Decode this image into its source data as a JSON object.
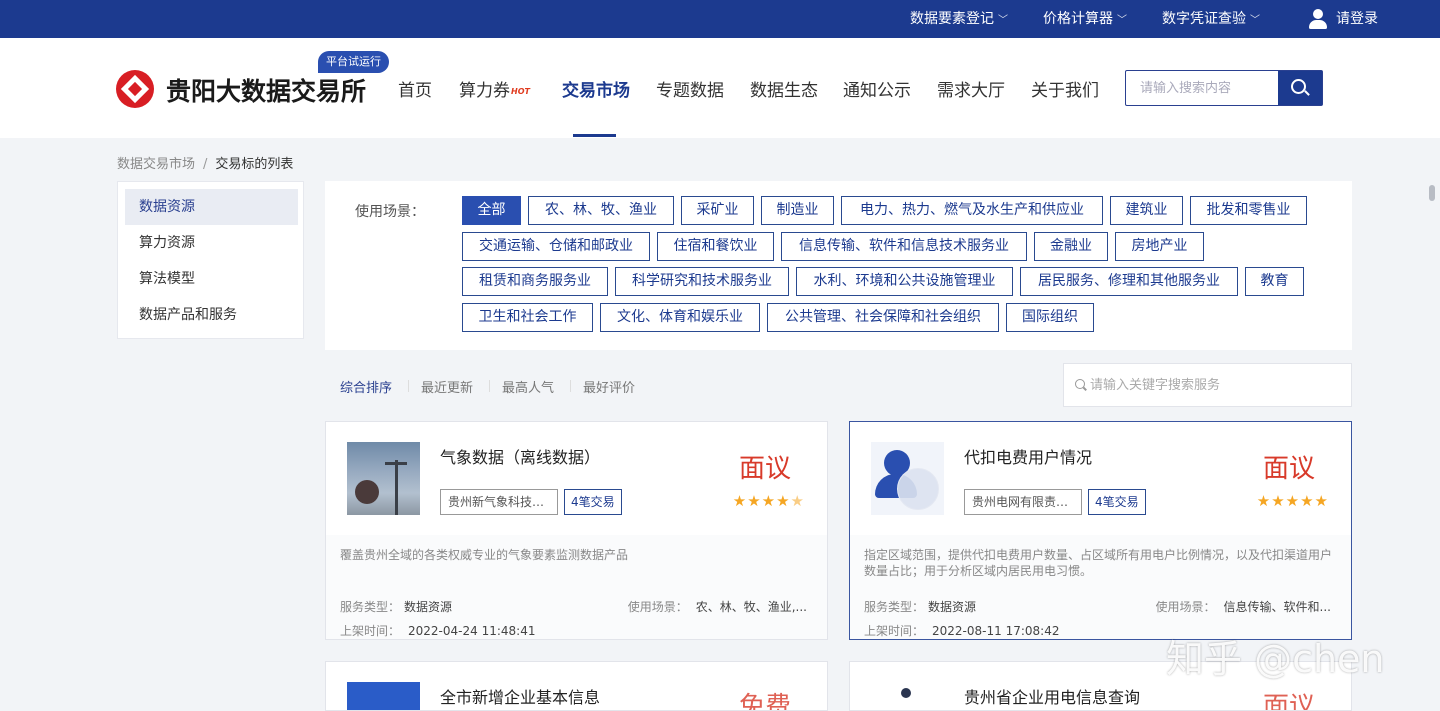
{
  "topbar": {
    "links": [
      {
        "label": "数据要素登记",
        "chevron": "﹀"
      },
      {
        "label": "价格计算器",
        "chevron": "﹀"
      },
      {
        "label": "数字凭证查验",
        "chevron": "﹀"
      }
    ],
    "login_label": "请登录"
  },
  "header": {
    "logo_text": "贵阳大数据交易所",
    "trial_badge": "平台试运行",
    "nav": [
      {
        "label": "首页"
      },
      {
        "label": "算力券"
      },
      {
        "label": "交易市场"
      },
      {
        "label": "专题数据"
      },
      {
        "label": "数据生态"
      },
      {
        "label": "通知公示"
      },
      {
        "label": "需求大厅"
      },
      {
        "label": "关于我们"
      }
    ],
    "hot_badge": "HOT",
    "search_placeholder": "请输入搜索内容"
  },
  "breadcrumb": {
    "parent": "数据交易市场",
    "separator": "/",
    "current": "交易标的列表"
  },
  "sidebar": {
    "items": [
      {
        "label": "数据资源"
      },
      {
        "label": "算力资源"
      },
      {
        "label": "算法模型"
      },
      {
        "label": "数据产品和服务"
      }
    ]
  },
  "filter": {
    "label": "使用场景：",
    "tags": [
      "全部",
      "农、林、牧、渔业",
      "采矿业",
      "制造业",
      "电力、热力、燃气及水生产和供应业",
      "建筑业",
      "批发和零售业",
      "交通运输、仓储和邮政业",
      "住宿和餐饮业",
      "信息传输、软件和信息技术服务业",
      "金融业",
      "房地产业",
      "租赁和商务服务业",
      "科学研究和技术服务业",
      "水利、环境和公共设施管理业",
      "居民服务、修理和其他服务业",
      "教育",
      "卫生和社会工作",
      "文化、体育和娱乐业",
      "公共管理、社会保障和社会组织",
      "国际组织"
    ]
  },
  "sort": {
    "options": [
      "综合排序",
      "最近更新",
      "最高人气",
      "最好评价"
    ],
    "search_placeholder": "请输入关键字搜索服务"
  },
  "cards": [
    {
      "title": "气象数据（离线数据）",
      "org": "贵州新气象科技有限责任公司",
      "count": "4笔交易",
      "price": "面议",
      "stars": "★★★★",
      "half_star": "★",
      "desc": "覆盖贵州全域的各类权威专业的气象要素监测数据产品",
      "service_type_label": "服务类型：",
      "service_type": "数据资源",
      "scenario_label": "使用场景：",
      "scenario": "农、林、牧、渔业,...",
      "time_label": "上架时间：",
      "time": "2022-04-24 11:48:41"
    },
    {
      "title": "代扣电费用户情况",
      "org": "贵州电网有限责任公司",
      "count": "4笔交易",
      "price": "面议",
      "stars": "★★★★★",
      "desc": "指定区域范围，提供代扣电费用户数量、占区域所有用电户比例情况，以及代扣渠道用户数量占比；用于分析区域内居民用电习惯。",
      "service_type_label": "服务类型：",
      "service_type": "数据资源",
      "scenario_label": "使用场景：",
      "scenario": "信息传输、软件和...",
      "time_label": "上架时间：",
      "time": "2022-08-11 17:08:42"
    },
    {
      "title": "全市新增企业基本信息",
      "price": "免费"
    },
    {
      "title": "贵州省企业用电信息查询",
      "price": "面议"
    }
  ],
  "watermark": "知乎 @chen"
}
